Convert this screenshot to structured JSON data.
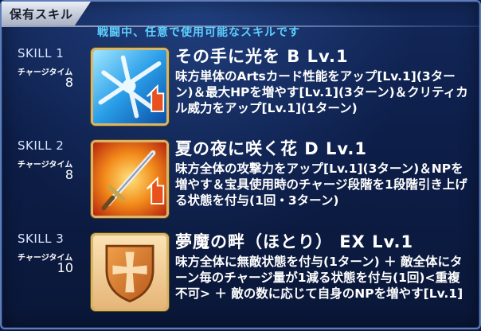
{
  "header": {
    "title": "保有スキル",
    "subtitle": "戦闘中、任意で使用可能なスキルです"
  },
  "charge_label": "チャージタイム",
  "colors": {
    "background": "#0d1e49",
    "subtitle": "#5fd0ff",
    "icon_border": "#d7b56a"
  },
  "skills": [
    {
      "slot": "SKILL 1",
      "charge_time": "8",
      "name": "その手に光を B Lv.1",
      "description": "味方単体のArtsカード性能をアップ[Lv.1](3ターン)＆最大HPを増やす[Lv.1](3ターン)＆クリティカル威力をアップ[Lv.1](1ターン)",
      "icon": "arts-up-icon"
    },
    {
      "slot": "SKILL 2",
      "charge_time": "8",
      "name": "夏の夜に咲く花 D Lv.1",
      "description": "味方全体の攻撃力をアップ[Lv.1](3ターン)＆NPを増やす＆宝具使用時のチャージ段階を1段階引き上げる状態を付与(1回・3ターン)",
      "icon": "sword-attack-up-icon"
    },
    {
      "slot": "SKILL 3",
      "charge_time": "10",
      "name": "夢魔の畔（ほとり） EX Lv.1",
      "description": "味方全体に無敵状態を付与(1ターン) ＋ 敵全体にターン毎のチャージ量が1減る状態を付与(1回)<重複不可> ＋ 敵の数に応じて自身のNPを増やす[Lv.1]",
      "icon": "shield-invincible-icon"
    }
  ]
}
